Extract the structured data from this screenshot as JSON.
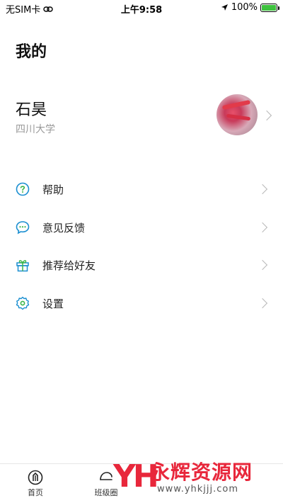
{
  "status_bar": {
    "carrier": "无SIM卡",
    "time": "上午9:58",
    "battery": "100%",
    "battery_level": 1.0
  },
  "page": {
    "title": "我的"
  },
  "profile": {
    "name": "石昊",
    "school": "四川大学"
  },
  "menu": {
    "items": [
      {
        "label": "帮助",
        "icon": "help-icon"
      },
      {
        "label": "意见反馈",
        "icon": "feedback-icon"
      },
      {
        "label": "推荐给好友",
        "icon": "gift-icon"
      },
      {
        "label": "设置",
        "icon": "gear-icon"
      }
    ]
  },
  "tabbar": {
    "tabs": [
      {
        "label": "首页",
        "icon": "home-icon"
      },
      {
        "label": "班级圈",
        "icon": "circle-icon"
      }
    ]
  },
  "watermark": {
    "logo": "YH",
    "title": "永辉资源网",
    "url": "www.yhkjjj.com"
  },
  "colors": {
    "accent": "#1b8fd1",
    "green": "#3bb54a",
    "watermark": "#e8273b"
  }
}
